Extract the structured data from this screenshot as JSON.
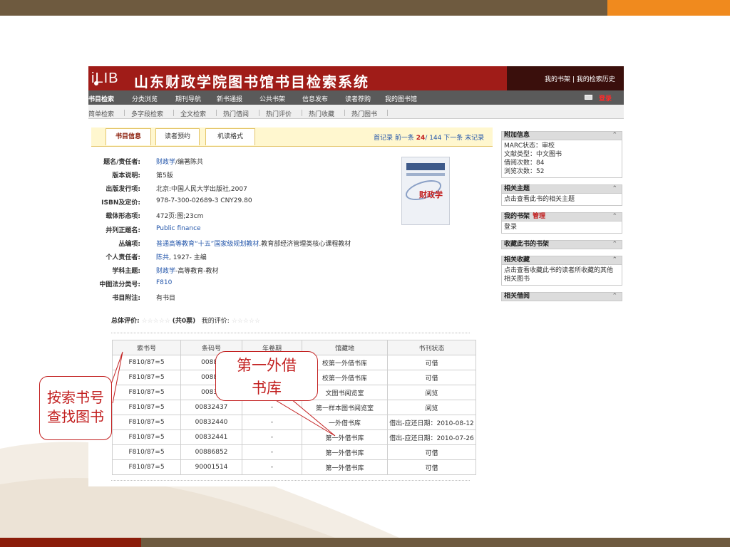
{
  "slide": {
    "colors": {
      "band": "#6e5a3f",
      "accent_orange": "#f08a1e",
      "accent_red": "#8b1d0a",
      "callout": "#c21f1f"
    }
  },
  "header": {
    "logo": "iLIB",
    "title": "山东财政学院图书馆书目检索系统",
    "links": "我的书架 | 我的检索历史",
    "login": "登录"
  },
  "nav": {
    "items": [
      "书目检索",
      "分类浏览",
      "期刊导航",
      "新书通报",
      "公共书架",
      "信息发布",
      "读者荐购",
      "我的图书馆"
    ]
  },
  "subnav": {
    "items": [
      "简单检索",
      "多字段检索",
      "全文检索",
      "热门借阅",
      "热门评价",
      "热门收藏",
      "热门图书"
    ]
  },
  "tabs": [
    "书目信息",
    "读者预约",
    "机读格式"
  ],
  "pager": {
    "first": "首记录",
    "prev": "前一条",
    "current": "24",
    "total": "/ 144",
    "next": "下一条",
    "last": "末记录"
  },
  "record": {
    "fields": [
      {
        "label": "题名/责任者:",
        "value_link": "财政学",
        "value": "/编著陈共"
      },
      {
        "label": "版本说明:",
        "value_link": "",
        "value": "第5版"
      },
      {
        "label": "出版发行项:",
        "value_link": "",
        "value": "北京:中国人民大学出版社,2007"
      },
      {
        "label": "ISBN及定价:",
        "value_link": "",
        "value": "978-7-300-02689-3 CNY29.80"
      },
      {
        "label": "载体形态项:",
        "value_link": "",
        "value": "472页:图;23cm"
      },
      {
        "label": "并列正题名:",
        "value_link": "Public finance",
        "value": ""
      },
      {
        "label": "丛编项:",
        "value_link": "普通高等教育“十五”国家级规划教材",
        "value": ".教育部经济管理类核心课程教材"
      },
      {
        "label": "个人责任者:",
        "value_link": "陈共",
        "value": ", 1927- 主编"
      },
      {
        "label": "学科主题:",
        "value_link": "财政学",
        "value": "-高等教育-教材"
      },
      {
        "label": "中图法分类号:",
        "value_link": "F810",
        "value": ""
      },
      {
        "label": "书目附注:",
        "value_link": "",
        "value": "有书目"
      }
    ],
    "cover_title": "财政学",
    "rating_label": "总体评价:",
    "rating_count": "(共0票)",
    "my_rating_label": "我的评价:",
    "stars": "☆☆☆☆☆"
  },
  "holdings": {
    "headers": [
      "索书号",
      "条码号",
      "年卷期",
      "馆藏地",
      "书刊状态"
    ],
    "rows": [
      [
        "F810/87=5",
        "00886",
        "",
        "校第一外借书库",
        "可借"
      ],
      [
        "F810/87=5",
        "00886",
        "",
        "校第一外借书库",
        "可借"
      ],
      [
        "F810/87=5",
        "00832",
        "",
        "文图书阅览室",
        "阅览"
      ],
      [
        "F810/87=5",
        "00832437",
        "-",
        "第一样本图书阅览室",
        "阅览"
      ],
      [
        "F810/87=5",
        "00832440",
        "-",
        "一外借书库",
        "借出-应还日期：2010-08-12"
      ],
      [
        "F810/87=5",
        "00832441",
        "-",
        "第一外借书库",
        "借出-应还日期：2010-07-26"
      ],
      [
        "F810/87=5",
        "00886852",
        "-",
        "第一外借书库",
        "可借"
      ],
      [
        "F810/87=5",
        "90001514",
        "-",
        "第一外借书库",
        "可借"
      ]
    ]
  },
  "sidebar": {
    "panels": [
      {
        "title": "附加信息",
        "manage": "",
        "body": [
          "MARC状态：审校",
          "文献类型：中文图书",
          "借阅次数：84",
          "浏览次数：52"
        ]
      },
      {
        "title": "相关主题",
        "manage": "",
        "body": [
          "点击查看此书的相关主题"
        ]
      },
      {
        "title": "我的书架",
        "manage": "管理",
        "body": [
          "登录"
        ]
      },
      {
        "title": "收藏此书的书架",
        "manage": "",
        "body": []
      },
      {
        "title": "相关收藏",
        "manage": "",
        "body": [
          "点击查看收藏此书的读者所收藏的其他",
          "相关图书"
        ]
      },
      {
        "title": "相关借阅",
        "manage": "",
        "body": []
      }
    ]
  },
  "callouts": {
    "big_line1": "第一外借",
    "big_line2": "书库",
    "small_line1": "按索书号",
    "small_line2": "查找图书"
  }
}
